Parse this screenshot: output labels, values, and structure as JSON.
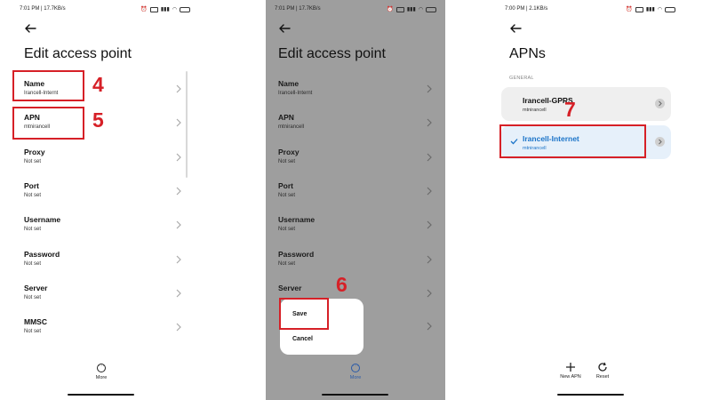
{
  "screen1": {
    "status": {
      "time": "7:01 PM | 17.7KB/s",
      "icons": [
        "alarm-icon",
        "vpn-icon",
        "signal-icon",
        "wifi-icon",
        "battery-icon"
      ]
    },
    "title": "Edit access point",
    "items": [
      {
        "label": "Name",
        "value": "Irancell-Internt"
      },
      {
        "label": "APN",
        "value": "mtnirancell"
      },
      {
        "label": "Proxy",
        "value": "Not set"
      },
      {
        "label": "Port",
        "value": "Not set"
      },
      {
        "label": "Username",
        "value": "Not set"
      },
      {
        "label": "Password",
        "value": "Not set"
      },
      {
        "label": "Server",
        "value": "Not set"
      },
      {
        "label": "MMSC",
        "value": "Not set"
      }
    ],
    "more_label": "More",
    "annotations": [
      "4",
      "5"
    ]
  },
  "screen2": {
    "status": {
      "time": "7:01 PM | 17.7KB/s",
      "icons": [
        "alarm-icon",
        "vpn-icon",
        "signal-icon",
        "wifi-icon",
        "battery-icon"
      ]
    },
    "title": "Edit access point",
    "items": [
      {
        "label": "Name",
        "value": "Irancell-Internt"
      },
      {
        "label": "APN",
        "value": "mtnirancell"
      },
      {
        "label": "Proxy",
        "value": "Not set"
      },
      {
        "label": "Port",
        "value": "Not set"
      },
      {
        "label": "Username",
        "value": "Not set"
      },
      {
        "label": "Password",
        "value": "Not set"
      },
      {
        "label": "Server",
        "value": ""
      }
    ],
    "menu": {
      "save": "Save",
      "cancel": "Cancel"
    },
    "more_label": "More",
    "annotations": [
      "6"
    ],
    "dim_color": "#9e9e9e",
    "accent": "#2b5ba8"
  },
  "screen3": {
    "status": {
      "time": "7:00 PM | 2.1KB/s",
      "icons": [
        "alarm-icon",
        "vpn-icon",
        "signal-icon",
        "wifi-icon",
        "battery-icon"
      ]
    },
    "title": "APNs",
    "section": "GENERAL",
    "apns": [
      {
        "name": "Irancell-GPRS",
        "sub": "mtnirancell",
        "selected": false
      },
      {
        "name": "Irancell-Internet",
        "sub": "mtnirancell",
        "selected": true
      }
    ],
    "toolbar": {
      "new_apn": "New APN",
      "reset": "Reset"
    },
    "annotations": [
      "7"
    ],
    "selected_color": "#1a73c8",
    "selected_bg": "#e6f0fa"
  },
  "annotation_color": "#d62027"
}
